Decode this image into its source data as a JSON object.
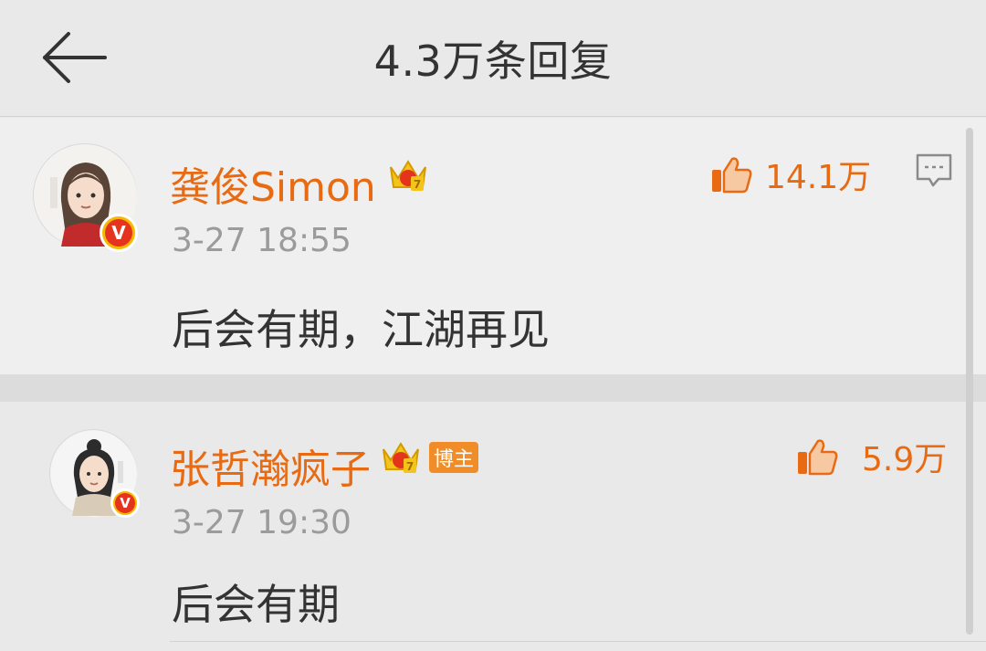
{
  "header": {
    "title": "4.3万条回复"
  },
  "comments": [
    {
      "author": "龚俊Simon",
      "time": "3-27 18:55",
      "text": "后会有期，江湖再见",
      "likes": "14.1万",
      "crown_level": "7"
    },
    {
      "author": "张哲瀚疯子",
      "badge": "博主",
      "time": "3-27 19:30",
      "text": "后会有期",
      "likes": "5.9万",
      "crown_level": "7"
    }
  ],
  "colors": {
    "accent": "#e86a12",
    "muted": "#9b9b9b",
    "text": "#333333"
  },
  "icons": [
    "back-arrow-icon",
    "thumbs-up-icon",
    "reply-icon",
    "crown-icon",
    "verified-icon"
  ]
}
